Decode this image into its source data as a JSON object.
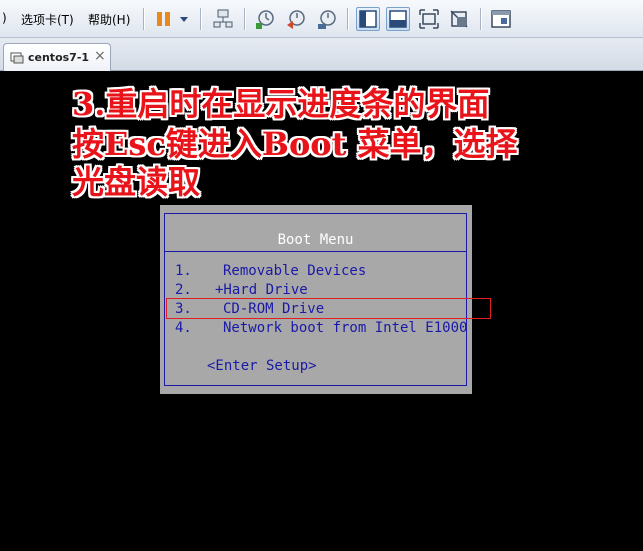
{
  "menu": {
    "fragment": ")",
    "tabs_label": "选项卡(T)",
    "help_label": "帮助(H)"
  },
  "toolbar": {
    "icons": [
      "pause-icon",
      "dropdown-arrow-icon",
      "network-icon",
      "snapshot-take-icon",
      "snapshot-revert-icon",
      "snapshot-manager-icon",
      "console-view-icon",
      "full-width-icon",
      "fullscreen-icon",
      "unity-icon",
      "thumbnail-icon"
    ],
    "accent": "#e8891e"
  },
  "tab": {
    "label": "centos7-1",
    "close": "×"
  },
  "annotation": {
    "line1": "3.重启时在显示进度条的界面",
    "line2": "按Esc键进入Boot 菜单，选择",
    "line3": "光盘读取",
    "color": "#e8141a"
  },
  "boot_menu": {
    "title": "Boot Menu",
    "items": [
      {
        "num": "1.",
        "label": "Removable Devices"
      },
      {
        "num": "2.",
        "label": "+Hard Drive"
      },
      {
        "num": "3.",
        "label": "CD-ROM Drive"
      },
      {
        "num": "4.",
        "label": "Network boot from Intel E1000"
      }
    ],
    "setup": "<Enter Setup>",
    "panel_color": "#a8a8a8",
    "text_color": "#1a1aa6",
    "highlight_color": "#e02020"
  }
}
